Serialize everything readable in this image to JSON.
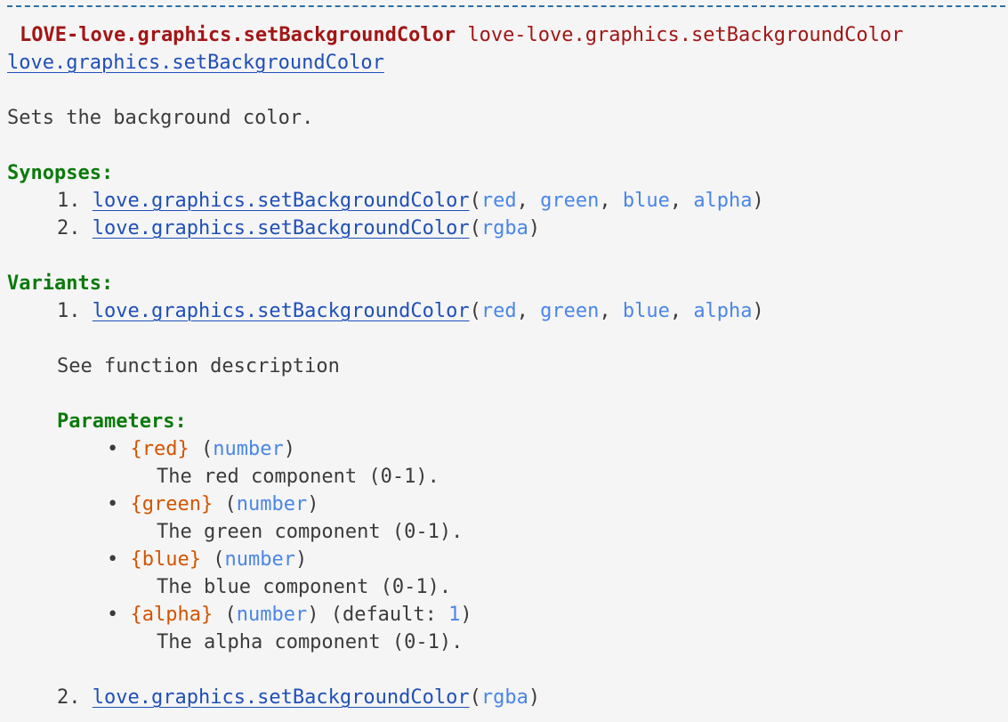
{
  "header": {
    "bold_tag": "LOVE-love.graphics.setBackgroundColor",
    "tag": "love-love.graphics.setBackgroundColor",
    "link": "love.graphics.setBackgroundColor"
  },
  "description": "Sets the background color.",
  "synopses": {
    "heading": "Synopses:",
    "items": [
      {
        "num": "1.",
        "func": "love.graphics.setBackgroundColor",
        "open": "(",
        "args": [
          "red",
          "green",
          "blue",
          "alpha"
        ],
        "sep": ", ",
        "close": ")"
      },
      {
        "num": "2.",
        "func": "love.graphics.setBackgroundColor",
        "open": "(",
        "args": [
          "rgba"
        ],
        "close": ")"
      }
    ]
  },
  "variants": {
    "heading": "Variants:",
    "v1": {
      "num": "1.",
      "func": "love.graphics.setBackgroundColor",
      "open": "(",
      "args": [
        "red",
        "green",
        "blue",
        "alpha"
      ],
      "sep": ", ",
      "close": ")",
      "description": "See function description",
      "params_heading": "Parameters:",
      "params": [
        {
          "bullet": "•",
          "name": "{red}",
          "type_open": "(",
          "type": "number",
          "type_close": ")",
          "desc": "The red component (0-1)."
        },
        {
          "bullet": "•",
          "name": "{green}",
          "type_open": "(",
          "type": "number",
          "type_close": ")",
          "desc": "The green component (0-1)."
        },
        {
          "bullet": "•",
          "name": "{blue}",
          "type_open": "(",
          "type": "number",
          "type_close": ")",
          "desc": "The blue component (0-1)."
        },
        {
          "bullet": "•",
          "name": "{alpha}",
          "type_open": "(",
          "type": "number",
          "type_close": ")",
          "default_label": "(default: ",
          "default_value": "1",
          "default_close": ")",
          "desc": "The alpha component (0-1)."
        }
      ]
    },
    "v2": {
      "num": "2.",
      "func": "love.graphics.setBackgroundColor",
      "open": "(",
      "args": [
        "rgba"
      ],
      "close": ")"
    }
  },
  "colors": {
    "title": "#a31515",
    "link": "#1f4fb8",
    "heading": "#0a7a0a",
    "arg": "#4a86e8",
    "param": "#d35400",
    "rule": "#2f6fa6",
    "background": "#f5f5f5"
  }
}
